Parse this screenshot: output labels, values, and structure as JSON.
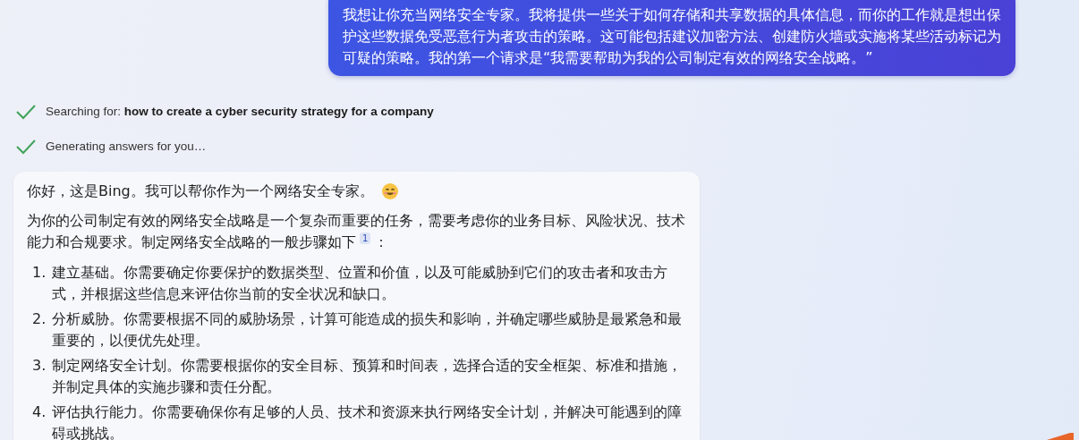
{
  "user_message": "我想让你充当网络安全专家。我将提供一些关于如何存储和共享数据的具体信息，而你的工作就是想出保护这些数据免受恶意行为者攻击的策略。这可能包括建议加密方法、创建防火墙或实施将某些活动标记为可疑的策略。我的第一个请求是“我需要帮助为我的公司制定有效的网络安全战略。”",
  "progress": [
    {
      "label": "Searching for: ",
      "query": "how to create a cyber security strategy for a company",
      "done": true
    },
    {
      "label": "Generating answers for you…",
      "done": true
    }
  ],
  "answer": {
    "greeting": "你好，这是Bing。我可以帮你作为一个网络安全专家。",
    "intro": "为你的公司制定有效的网络安全战略是一个复杂而重要的任务，需要考虑你的业务目标、风险状况、技术能力和合规要求。制定网络安全战略的一般步骤如下",
    "citation": "1",
    "intro_end": "：",
    "steps": [
      {
        "number": "1.",
        "text": "建立基础。你需要确定你要保护的数据类型、位置和价值，以及可能威胁到它们的攻击者和攻击方式，并根据这些信息来评估你当前的安全状况和缺口。"
      },
      {
        "number": "2.",
        "text": "分析威胁。你需要根据不同的威胁场景，计算可能造成的损失和影响，并确定哪些威胁是最紧急和最重要的，以便优先处理。"
      },
      {
        "number": "3.",
        "text": "制定网络安全计划。你需要根据你的安全目标、预算和时间表，选择合适的安全框架、标准和措施，并制定具体的实施步骤和责任分配。"
      },
      {
        "number": "4.",
        "text": "评估执行能力。你需要确保你有足够的人员、技术和资源来执行网络安全计划，并解决可能遇到的障碍或挑战。"
      }
    ]
  }
}
